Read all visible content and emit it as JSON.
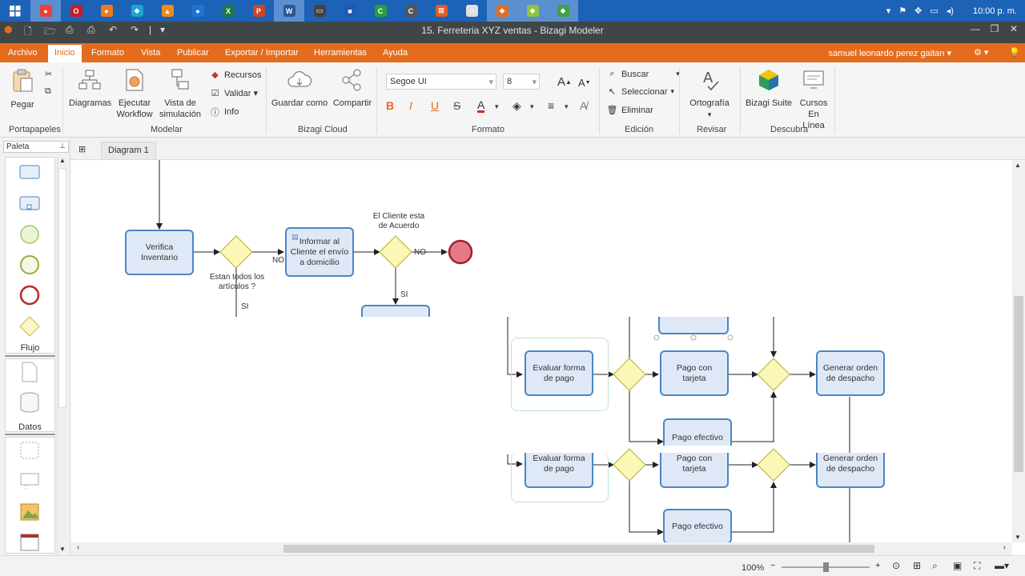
{
  "taskbar": {
    "apps": [
      {
        "name": "chrome",
        "color": "#e94235",
        "glyph": "●",
        "active": true
      },
      {
        "name": "opera",
        "color": "#cc1a26",
        "glyph": "O"
      },
      {
        "name": "firefox",
        "color": "#f07b1d",
        "glyph": "●"
      },
      {
        "name": "kodi",
        "color": "#1ea3d6",
        "glyph": "◆"
      },
      {
        "name": "vlc",
        "color": "#f08a1c",
        "glyph": "▲"
      },
      {
        "name": "app-blue",
        "color": "#1e73d6",
        "glyph": "●"
      },
      {
        "name": "excel",
        "color": "#1e7a45",
        "glyph": "X"
      },
      {
        "name": "powerpoint",
        "color": "#cc4727",
        "glyph": "P"
      },
      {
        "name": "word",
        "color": "#2b5797",
        "glyph": "W",
        "active": true
      },
      {
        "name": "monitor",
        "color": "#444",
        "glyph": "▭"
      },
      {
        "name": "app-shield",
        "color": "#1e5ab4",
        "glyph": "■"
      },
      {
        "name": "camtasia",
        "color": "#2a9e3a",
        "glyph": "C"
      },
      {
        "name": "app-c",
        "color": "#555",
        "glyph": "C"
      },
      {
        "name": "app-orange",
        "color": "#e15b2a",
        "glyph": "⊠"
      },
      {
        "name": "app-cube",
        "color": "#e0e0e0",
        "glyph": "◇"
      },
      {
        "name": "bizagi",
        "color": "#e46c1c",
        "glyph": "◆",
        "active": true
      },
      {
        "name": "app-green",
        "color": "#8cc63e",
        "glyph": "◆",
        "active": true
      },
      {
        "name": "app-leaf",
        "color": "#3fa142",
        "glyph": "◆",
        "active": true
      }
    ],
    "clock": "10:00 p. m."
  },
  "window": {
    "title": "15. Ferreteria XYZ ventas - Bizagi Modeler"
  },
  "menu": {
    "items": [
      "Archivo",
      "Inicio",
      "Formato",
      "Vista",
      "Publicar",
      "Exportar / Importar",
      "Herramientas",
      "Ayuda"
    ],
    "user": "samuel leonardo perez gaitan"
  },
  "ribbon": {
    "pegar": "Pegar",
    "portapapeles": "Portapapeles",
    "diagramas": "Diagramas",
    "ejecutar": [
      "Ejecutar",
      "Workflow"
    ],
    "vista_sim": [
      "Vista de",
      "simulación"
    ],
    "recursos": "Recursos",
    "validar": "Validar",
    "info": "Info",
    "modelar": "Modelar",
    "guardar_como": "Guardar como",
    "compartir": "Compartir",
    "bizagi_cloud": "Bizagi Cloud",
    "font_name": "Segoe UI",
    "font_size": "8",
    "formato": "Formato",
    "buscar": "Buscar",
    "seleccionar": "Seleccionar",
    "eliminar": "Eliminar",
    "edicion": "Edición",
    "ortografia": "Ortografía",
    "revisar": "Revisar",
    "bizagi_suite": "Bizagi Suite",
    "cursos": [
      "Cursos",
      "En Línea"
    ],
    "descubra": "Descubra"
  },
  "palette": {
    "header": "Paleta",
    "flujo": "Flujo",
    "datos": "Datos"
  },
  "tab": {
    "label": "Diagram 1"
  },
  "diagram": {
    "verifica": [
      "Verifica",
      "Inventario"
    ],
    "gateway1_label": [
      "Estan todos los",
      "artículos ?"
    ],
    "no1": "NO",
    "si1": "SI",
    "informar": [
      "Informar al",
      "Cliente el envío",
      "a domicilio"
    ],
    "gateway2_label": [
      "El Cliente esta",
      "de Acuerdo"
    ],
    "no2": "NO",
    "si2": "SI",
    "evaluar": [
      "Evaluar forma",
      "de pago"
    ],
    "pago_tarjeta": [
      "Pago con",
      "tarjeta"
    ],
    "generar": [
      "Generar orden",
      "de despacho"
    ],
    "pago_efectivo": "Pago efectivo"
  },
  "status": {
    "zoom": "100%"
  }
}
